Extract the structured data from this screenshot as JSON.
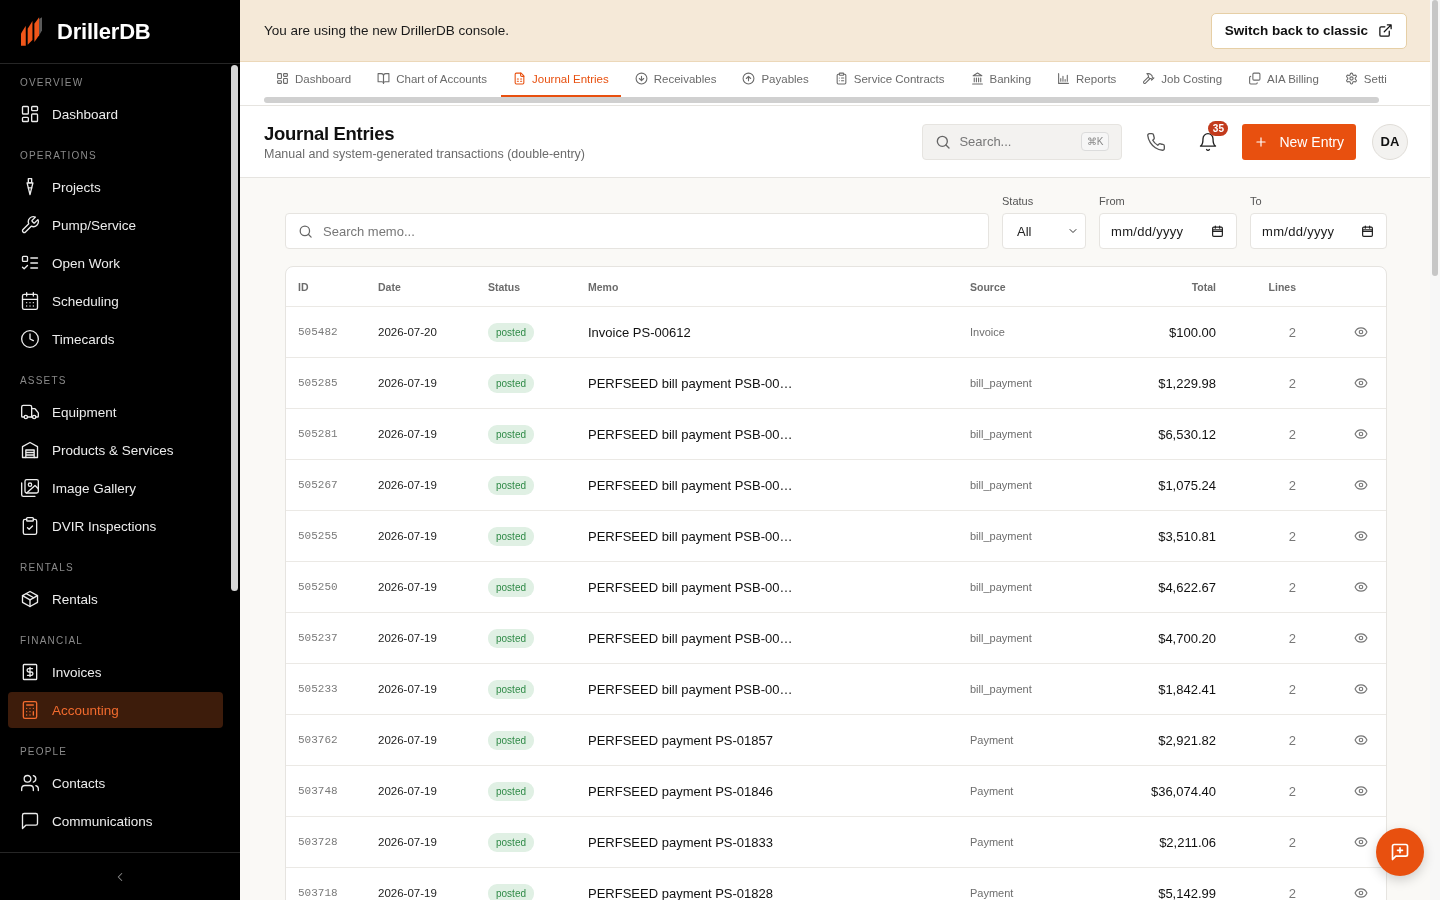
{
  "sidebar": {
    "brand": "DrillerDB",
    "sections": [
      {
        "label": "OVERVIEW",
        "items": [
          {
            "label": "Dashboard",
            "selected": false
          }
        ]
      },
      {
        "label": "OPERATIONS",
        "items": [
          {
            "label": "Projects",
            "selected": false
          },
          {
            "label": "Pump/Service",
            "selected": false
          },
          {
            "label": "Open Work",
            "selected": false
          },
          {
            "label": "Scheduling",
            "selected": false
          },
          {
            "label": "Timecards",
            "selected": false
          }
        ]
      },
      {
        "label": "ASSETS",
        "items": [
          {
            "label": "Equipment",
            "selected": false
          },
          {
            "label": "Products & Services",
            "selected": false
          },
          {
            "label": "Image Gallery",
            "selected": false
          },
          {
            "label": "DVIR Inspections",
            "selected": false
          }
        ]
      },
      {
        "label": "RENTALS",
        "items": [
          {
            "label": "Rentals",
            "selected": false
          }
        ]
      },
      {
        "label": "FINANCIAL",
        "items": [
          {
            "label": "Invoices",
            "selected": false
          },
          {
            "label": "Accounting",
            "selected": true
          }
        ]
      },
      {
        "label": "PEOPLE",
        "items": [
          {
            "label": "Contacts",
            "selected": false
          },
          {
            "label": "Communications",
            "selected": false
          }
        ]
      }
    ]
  },
  "banner": {
    "message": "You are using the new DrillerDB console.",
    "button": "Switch back to classic"
  },
  "tabs": [
    {
      "label": "Dashboard",
      "selected": false
    },
    {
      "label": "Chart of Accounts",
      "selected": false
    },
    {
      "label": "Journal Entries",
      "selected": true
    },
    {
      "label": "Receivables",
      "selected": false
    },
    {
      "label": "Payables",
      "selected": false
    },
    {
      "label": "Service Contracts",
      "selected": false
    },
    {
      "label": "Banking",
      "selected": false
    },
    {
      "label": "Reports",
      "selected": false
    },
    {
      "label": "Job Costing",
      "selected": false
    },
    {
      "label": "AIA Billing",
      "selected": false
    },
    {
      "label": "Setti",
      "selected": false
    }
  ],
  "header": {
    "title": "Journal Entries",
    "subtitle": "Manual and system-generated transactions (double-entry)",
    "search": {
      "placeholder": "Search...",
      "shortcut": "⌘K"
    },
    "notification_count": "35",
    "new_button": "New Entry",
    "avatar": "DA"
  },
  "filters": {
    "search": {
      "placeholder": "Search memo..."
    },
    "status": {
      "label": "Status",
      "value": "All"
    },
    "from": {
      "label": "From",
      "placeholder": "mm/dd/yyyy"
    },
    "to": {
      "label": "To",
      "placeholder": "mm/dd/yyyy"
    }
  },
  "table": {
    "columns": [
      "ID",
      "Date",
      "Status",
      "Memo",
      "Source",
      "Total",
      "Lines"
    ],
    "rows": [
      {
        "id": "505482",
        "date": "2026-07-20",
        "status": "posted",
        "memo": "Invoice PS-00612",
        "source": "Invoice",
        "total": "$100.00",
        "lines": "2"
      },
      {
        "id": "505285",
        "date": "2026-07-19",
        "status": "posted",
        "memo": "PERFSEED bill payment PSB-00…",
        "source": "bill_payment",
        "total": "$1,229.98",
        "lines": "2"
      },
      {
        "id": "505281",
        "date": "2026-07-19",
        "status": "posted",
        "memo": "PERFSEED bill payment PSB-00…",
        "source": "bill_payment",
        "total": "$6,530.12",
        "lines": "2"
      },
      {
        "id": "505267",
        "date": "2026-07-19",
        "status": "posted",
        "memo": "PERFSEED bill payment PSB-00…",
        "source": "bill_payment",
        "total": "$1,075.24",
        "lines": "2"
      },
      {
        "id": "505255",
        "date": "2026-07-19",
        "status": "posted",
        "memo": "PERFSEED bill payment PSB-00…",
        "source": "bill_payment",
        "total": "$3,510.81",
        "lines": "2"
      },
      {
        "id": "505250",
        "date": "2026-07-19",
        "status": "posted",
        "memo": "PERFSEED bill payment PSB-00…",
        "source": "bill_payment",
        "total": "$4,622.67",
        "lines": "2"
      },
      {
        "id": "505237",
        "date": "2026-07-19",
        "status": "posted",
        "memo": "PERFSEED bill payment PSB-00…",
        "source": "bill_payment",
        "total": "$4,700.20",
        "lines": "2"
      },
      {
        "id": "505233",
        "date": "2026-07-19",
        "status": "posted",
        "memo": "PERFSEED bill payment PSB-00…",
        "source": "bill_payment",
        "total": "$1,842.41",
        "lines": "2"
      },
      {
        "id": "503762",
        "date": "2026-07-19",
        "status": "posted",
        "memo": "PERFSEED payment PS-01857",
        "source": "Payment",
        "total": "$2,921.82",
        "lines": "2"
      },
      {
        "id": "503748",
        "date": "2026-07-19",
        "status": "posted",
        "memo": "PERFSEED payment PS-01846",
        "source": "Payment",
        "total": "$36,074.40",
        "lines": "2"
      },
      {
        "id": "503728",
        "date": "2026-07-19",
        "status": "posted",
        "memo": "PERFSEED payment PS-01833",
        "source": "Payment",
        "total": "$2,211.06",
        "lines": "2"
      },
      {
        "id": "503718",
        "date": "2026-07-19",
        "status": "posted",
        "memo": "PERFSEED payment PS-01828",
        "source": "Payment",
        "total": "$5,142.99",
        "lines": "2"
      }
    ]
  }
}
